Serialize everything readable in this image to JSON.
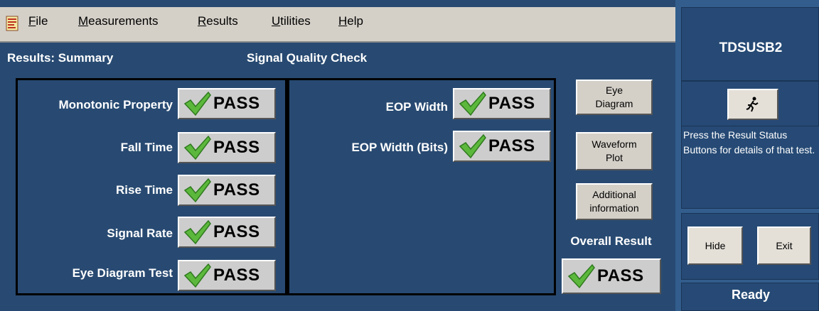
{
  "menu": [
    "File",
    "Measurements",
    "Results",
    "Utilities",
    "Help"
  ],
  "header": {
    "section": "Results: Summary",
    "subtitle": "Signal Quality Check"
  },
  "tests_left": [
    {
      "label": "Monotonic Property",
      "result": "PASS"
    },
    {
      "label": "Fall Time",
      "result": "PASS"
    },
    {
      "label": "Rise Time",
      "result": "PASS"
    },
    {
      "label": "Signal Rate",
      "result": "PASS"
    },
    {
      "label": "Eye Diagram Test",
      "result": "PASS"
    }
  ],
  "tests_mid": [
    {
      "label": "EOP Width",
      "result": "PASS"
    },
    {
      "label": "EOP Width (Bits)",
      "result": "PASS"
    }
  ],
  "side_buttons": {
    "eye_diagram": [
      "Eye",
      "Diagram"
    ],
    "waveform_plot": [
      "Waveform",
      "Plot"
    ],
    "additional_info": [
      "Additional",
      "information"
    ]
  },
  "overall": {
    "label": "Overall Result",
    "result": "PASS"
  },
  "right_panel": {
    "title": "TDSUSB2",
    "run_icon": "running-man-icon",
    "message": "Press the Result Status Buttons for details of that test.",
    "hide_label": "Hide",
    "exit_label": "Exit",
    "status": "Ready"
  },
  "colors": {
    "background": "#284a72",
    "check": "#5cb83c",
    "button": "#cdcdcd"
  }
}
